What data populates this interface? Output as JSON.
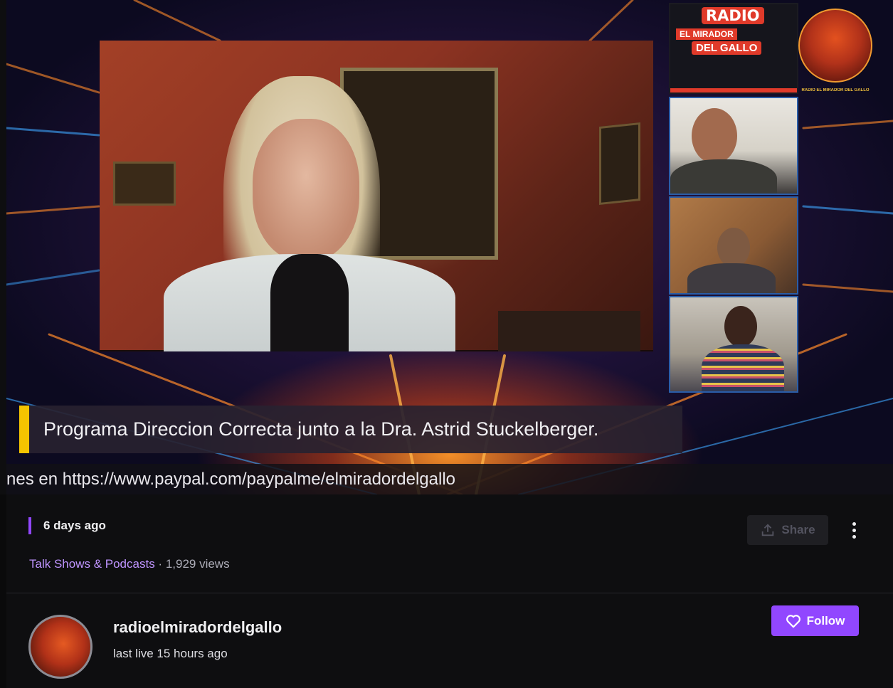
{
  "player": {
    "radio_logo": {
      "title": "RADIO",
      "line2": "EL MIRADOR",
      "line3": "DEL GALLO"
    },
    "logo_caption": "RADIO EL MIRADOR DEL GALLO",
    "caption": "Programa Direccion Correcta junto a la Dra. Astrid Stuckelberger.",
    "ticker": "nes en https://www.paypal.com/paypalme/elmiradordelgallo"
  },
  "video_info": {
    "date": "6 days ago",
    "category": "Talk Shows & Podcasts",
    "separator": " · ",
    "views": "1,929 views",
    "share_label": "Share",
    "accent_color": "#9147ff"
  },
  "channel": {
    "name": "radioelmiradordelgallo",
    "status": "last live 15 hours ago",
    "follow_label": "Follow"
  }
}
